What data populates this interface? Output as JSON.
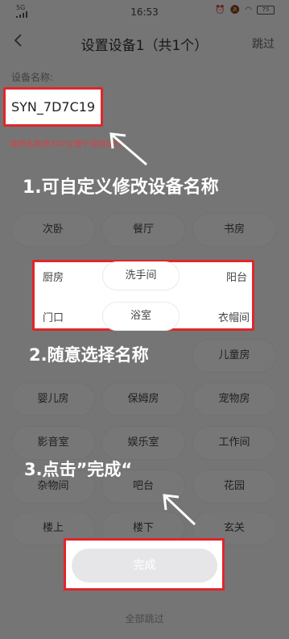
{
  "status_bar": {
    "network": "5G",
    "time": "16:53",
    "battery": "75"
  },
  "nav": {
    "title": "设置设备1（共1个）",
    "skip": "跳过"
  },
  "device": {
    "field_label": "设备名称:",
    "name_value": "SYN_7D7C19",
    "hint": "请把名称改为中文便于语音操作"
  },
  "rooms": {
    "row1": [
      "次卧",
      "餐厅",
      "书房"
    ],
    "row2": [
      "厨房",
      "洗手间",
      "阳台"
    ],
    "row3": [
      "门口",
      "浴室",
      "衣帽间"
    ],
    "row4_visible": "儿童房",
    "row5": [
      "婴儿房",
      "保姆房",
      "宠物房"
    ],
    "row6": [
      "影音室",
      "娱乐室",
      "工作间"
    ],
    "row7": [
      "杂物间",
      "吧台",
      "花园"
    ],
    "row8": [
      "楼上",
      "楼下",
      "玄关"
    ]
  },
  "footer": {
    "done": "完成",
    "skip_all": "全部跳过"
  },
  "annotations": {
    "step1": "1.可自定义修改设备名称",
    "step2": "2.随意选择名称",
    "step3": "3.点击”完成“"
  },
  "colors": {
    "highlight_red": "#e0262a",
    "overlay": "rgba(0,0,0,0.52)",
    "annotation_text": "#ffffff"
  }
}
